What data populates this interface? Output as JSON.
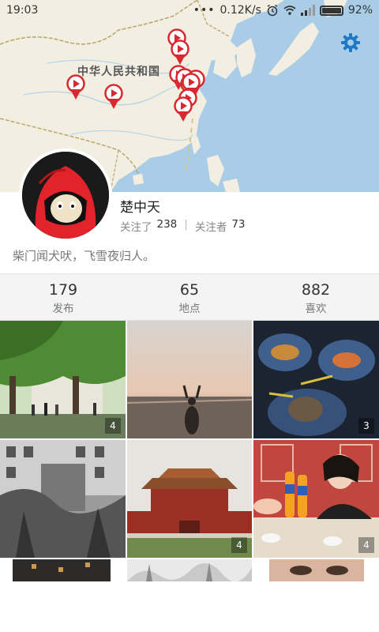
{
  "status_bar": {
    "time": "19:03",
    "net_speed": "0.12K/s",
    "battery": "92%",
    "battery_level": 0.92
  },
  "map": {
    "region_label": "中华人民共和国",
    "pin_icon": "video-pin-icon",
    "pin_color": "#d9282f"
  },
  "settings_icon": "gear-icon",
  "profile": {
    "name": "楚中天",
    "following_label": "关注了",
    "following_count": "238",
    "separator": "|",
    "followers_label": "关注者",
    "followers_count": "73",
    "bio": "柴门闻犬吠，飞雪夜归人。"
  },
  "stats": [
    {
      "value": "179",
      "label": "发布"
    },
    {
      "value": "65",
      "label": "地点"
    },
    {
      "value": "882",
      "label": "喜欢"
    }
  ],
  "photos": [
    {
      "count": "4"
    },
    {
      "count": ""
    },
    {
      "count": "3"
    },
    {
      "count": ""
    },
    {
      "count": "4"
    },
    {
      "count": "4"
    }
  ]
}
